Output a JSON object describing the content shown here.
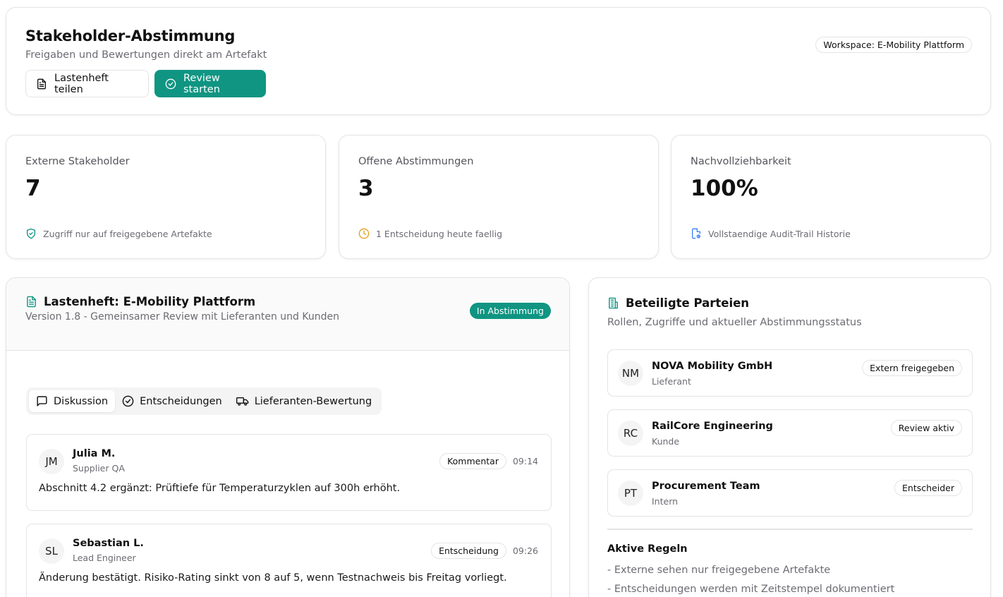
{
  "header": {
    "title": "Stakeholder-Abstimmung",
    "subtitle": "Freigaben und Bewertungen direkt am Artefakt",
    "share_button": "Lastenheft teilen",
    "review_button": "Review starten",
    "workspace": "Workspace: E-Mobility Plattform"
  },
  "stats": [
    {
      "label": "Externe Stakeholder",
      "value": "7",
      "note": "Zugriff nur auf freigegebene Artefakte",
      "icon": "shield-check-icon",
      "color": "#0f9582"
    },
    {
      "label": "Offene Abstimmungen",
      "value": "3",
      "note": "1 Entscheidung heute faellig",
      "icon": "clock-icon",
      "color": "#e0a021"
    },
    {
      "label": "Nachvollziehbarkeit",
      "value": "100%",
      "note": "Vollstaendige Audit-Trail Historie",
      "icon": "file-history-icon",
      "color": "#3b82f6"
    }
  ],
  "document": {
    "title": "Lastenheft: E-Mobility Plattform",
    "subtitle": "Version 1.8 - Gemeinsamer Review mit Lieferanten und Kunden",
    "status": "In Abstimmung",
    "tabs": [
      {
        "label": "Diskussion",
        "icon": "message-icon",
        "active": true
      },
      {
        "label": "Entscheidungen",
        "icon": "check-circle-icon",
        "active": false
      },
      {
        "label": "Lieferanten-Bewertung",
        "icon": "truck-icon",
        "active": false
      }
    ],
    "messages": [
      {
        "initials": "JM",
        "name": "Julia M.",
        "role": "Supplier QA",
        "type": "Kommentar",
        "time": "09:14",
        "text": "Abschnitt 4.2 ergänzt: Prüftiefe für Temperaturzyklen auf 300h erhöht."
      },
      {
        "initials": "SL",
        "name": "Sebastian L.",
        "role": "Lead Engineer",
        "type": "Entscheidung",
        "time": "09:26",
        "text": "Änderung bestätigt. Risiko-Rating sinkt von 8 auf 5, wenn Testnachweis bis Freitag vorliegt."
      }
    ]
  },
  "parties": {
    "title": "Beteiligte Parteien",
    "subtitle": "Rollen, Zugriffe und aktueller Abstimmungsstatus",
    "items": [
      {
        "initials": "NM",
        "name": "NOVA Mobility GmbH",
        "type": "Lieferant",
        "status": "Extern freigegeben"
      },
      {
        "initials": "RC",
        "name": "RailCore Engineering",
        "type": "Kunde",
        "status": "Review aktiv"
      },
      {
        "initials": "PT",
        "name": "Procurement Team",
        "type": "Intern",
        "status": "Entscheider"
      }
    ],
    "rules_title": "Aktive Regeln",
    "rules": [
      "- Externe sehen nur freigegebene Artefakte",
      "- Entscheidungen werden mit Zeitstempel dokumentiert"
    ]
  }
}
